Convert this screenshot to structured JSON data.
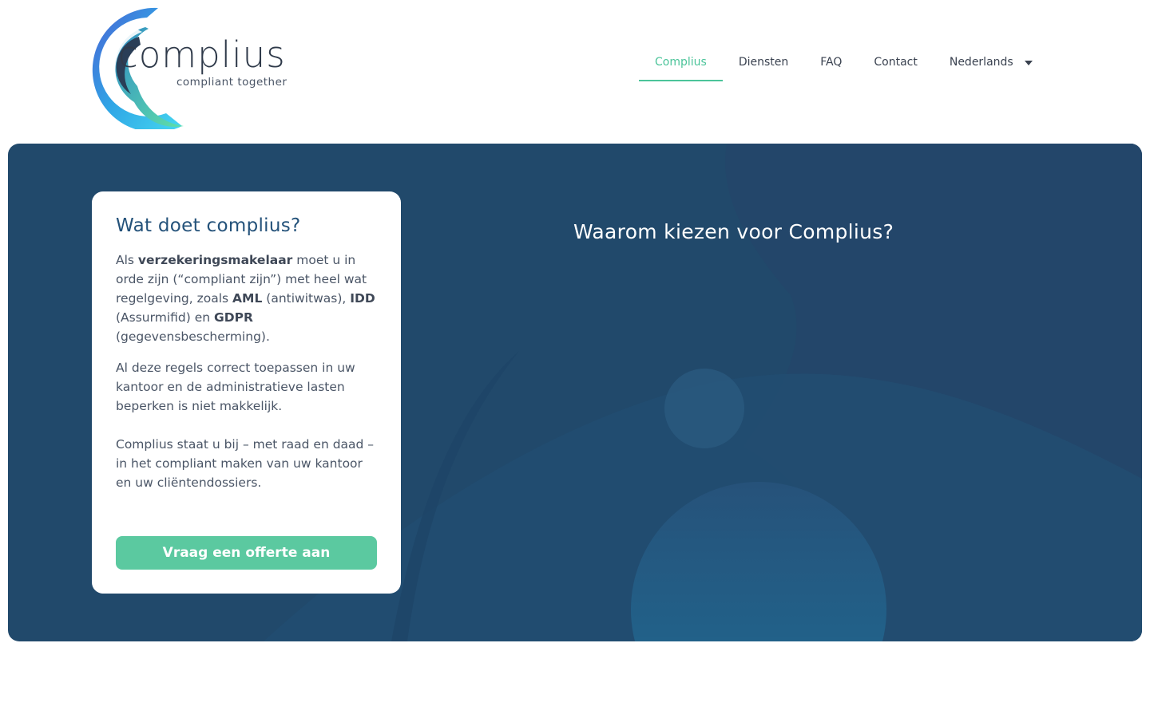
{
  "logo": {
    "wordmark": "complius",
    "tagline": "compliant together"
  },
  "nav": {
    "items": [
      {
        "label": "Complius",
        "active": true
      },
      {
        "label": "Diensten"
      },
      {
        "label": "FAQ"
      },
      {
        "label": "Contact"
      }
    ],
    "language": "Nederlands"
  },
  "card": {
    "title": "Wat doet complius?",
    "p1": {
      "a": "Als ",
      "b1": "verzekeringsmakelaar",
      "c": " moet u in orde zijn (“compliant zijn”) met heel wat regelgeving, zoals ",
      "b2": "AML",
      "d": " (antiwitwas), ",
      "b3": "IDD",
      "e": " (Assurmifid) en ",
      "b4": "GDPR",
      "f": " (gegevensbescherming)."
    },
    "p2": "Al deze regels correct toepassen in uw kantoor en de administratieve lasten beperken is niet makkelijk.",
    "p3": "Complius staat u bij – met raad en daad – in het compliant maken van uw kantoor en uw cliëntendossiers.",
    "cta": "Vraag een offerte aan"
  },
  "hero": {
    "heading": "Waarom kiezen voor Complius?"
  },
  "colors": {
    "accent": "#5bc9a0",
    "nav_active": "#4cc49a",
    "hero_bg": "#21496b",
    "title_blue": "#24527a"
  }
}
